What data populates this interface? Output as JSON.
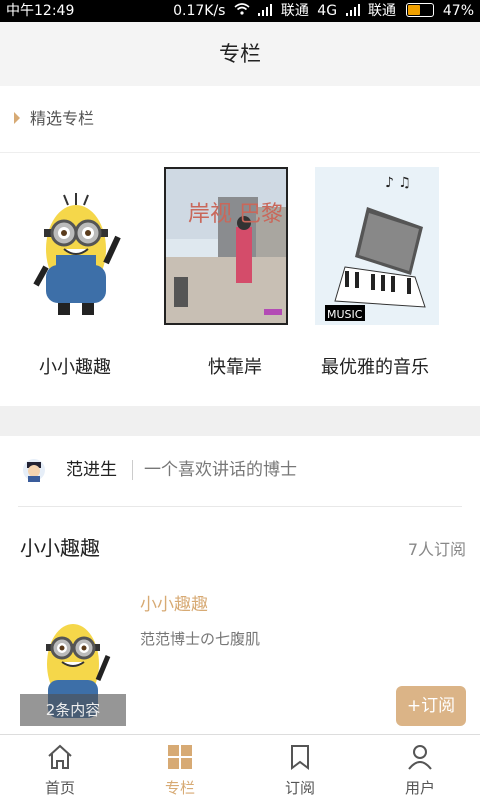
{
  "status_bar": {
    "time": "中午12:49",
    "speed": "0.17K/s",
    "carrier1": "联通",
    "network": "4G",
    "carrier2": "联通",
    "battery": "47%"
  },
  "header": {
    "title": "专栏"
  },
  "featured": {
    "section_label": "精选专栏",
    "items": [
      {
        "title": "小小趣趣",
        "thumb": "minion"
      },
      {
        "title": "快靠岸",
        "thumb": "city-cover"
      },
      {
        "title": "最优雅的音乐",
        "thumb": "piano"
      }
    ],
    "cover_texts": {
      "city_cover_big": "岸视 巴黎",
      "piano_label": "MUSIC"
    }
  },
  "column_card": {
    "author_name": "范进生",
    "author_bio": "一个喜欢讲话的博士",
    "title": "小小趣趣",
    "subscribers": "7人订阅",
    "item_title": "小小趣趣",
    "item_desc": "范范博士の七腹肌",
    "item_badge": "2条内容",
    "subscribe_label": "+订阅"
  },
  "tabbar": {
    "tabs": [
      {
        "label": "首页",
        "icon": "home-icon"
      },
      {
        "label": "专栏",
        "icon": "grid-icon"
      },
      {
        "label": "订阅",
        "icon": "bookmark-icon"
      },
      {
        "label": "用户",
        "icon": "user-icon"
      }
    ],
    "active_index": 1
  },
  "colors": {
    "accent": "#d7aa74",
    "button": "#dbb487"
  }
}
